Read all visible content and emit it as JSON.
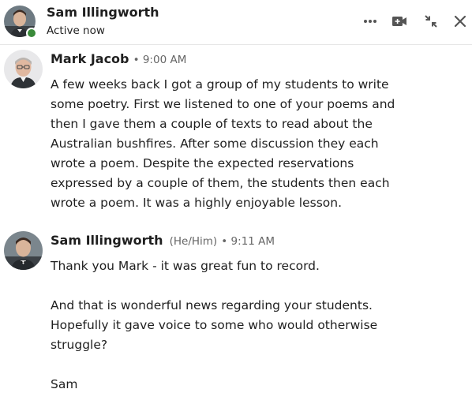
{
  "header": {
    "name": "Sam Illingworth",
    "status": "Active now",
    "icons": [
      "more-options-icon",
      "video-call-icon",
      "collapse-icon",
      "close-icon"
    ]
  },
  "messages": [
    {
      "author": "Mark Jacob",
      "pronouns": "",
      "time": "• 9:00 AM",
      "paragraphs": [
        "A few weeks back I got a group of my students to write\nsome poetry. First we listened to one of your poems and\nthen I gave them a couple of texts to read about the\nAustralian bushfires. After some discussion they each\nwrote a poem. Despite the expected reservations\nexpressed by a couple of them, the students then each\nwrote a poem. It was a highly enjoyable lesson."
      ]
    },
    {
      "author": "Sam Illingworth",
      "pronouns": "(He/Him)",
      "time": "• 9:11 AM",
      "paragraphs": [
        "Thank you Mark - it was great fun to record.",
        "And that is wonderful news regarding your students.\nHopefully it gave voice to some who would otherwise\nstruggle?",
        "Sam"
      ]
    }
  ],
  "colors": {
    "presence": "#3a8a3a",
    "divider": "#e6e6e6",
    "meta_text": "#666666"
  }
}
